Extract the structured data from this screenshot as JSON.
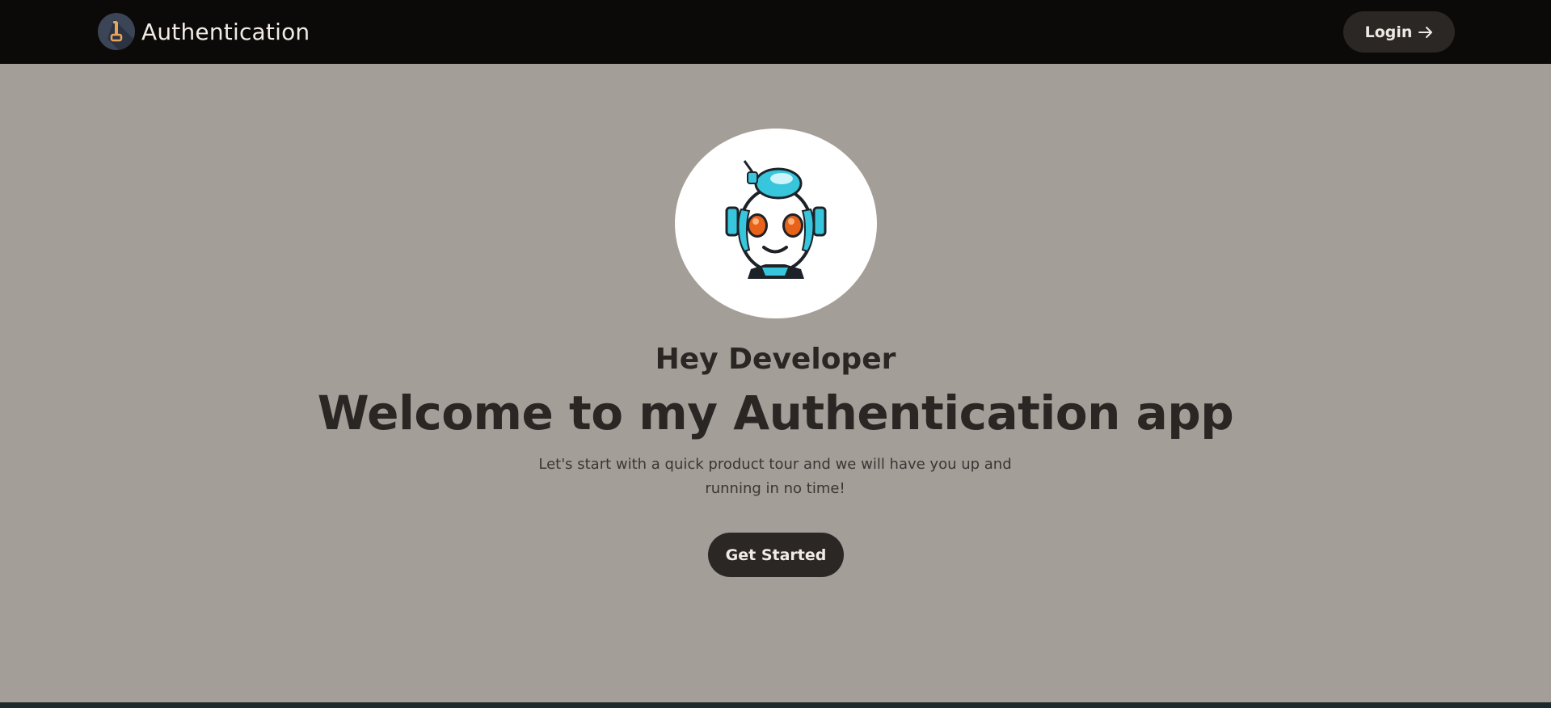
{
  "navbar": {
    "brand_title": "Authentication",
    "login_label": "Login",
    "login_icon": "arrow-right-icon"
  },
  "hero": {
    "avatar_icon": "robot-avatar",
    "greeting": "Hey Developer",
    "headline": "Welcome to my Authentication app",
    "subtitle": "Let's start with a quick product tour and we will have you up and running in no time!",
    "cta_label": "Get Started"
  },
  "colors": {
    "navbar_bg": "#0c0a08",
    "page_bg": "#a39e97",
    "button_bg": "#2b2725",
    "text_dark": "#2a2624"
  }
}
